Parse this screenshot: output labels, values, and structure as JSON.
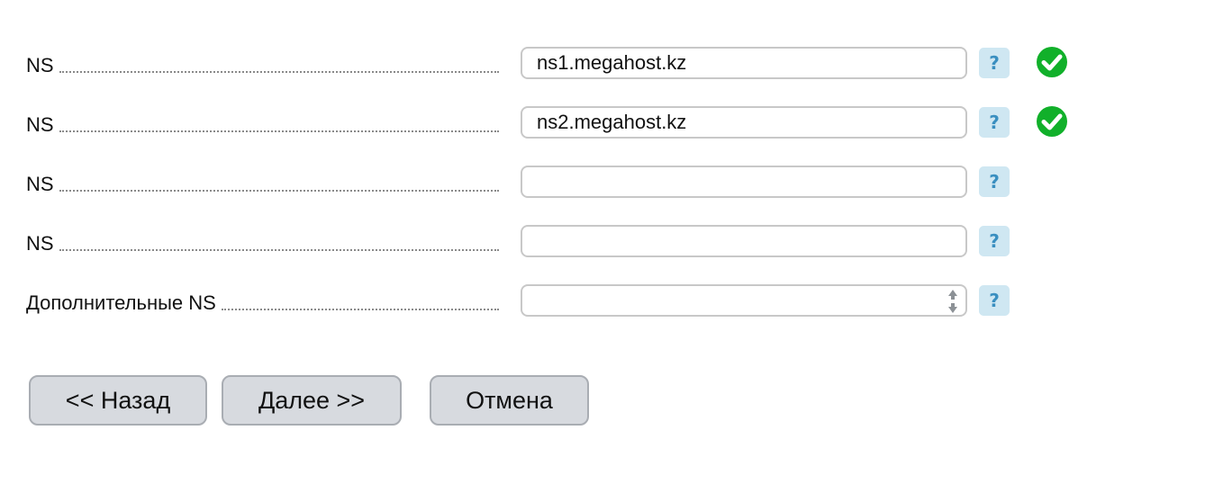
{
  "help_glyph": "?",
  "rows": [
    {
      "label": "NS",
      "value": "ns1.megahost.kz",
      "placeholder": "",
      "status": "valid"
    },
    {
      "label": "NS",
      "value": "ns2.megahost.kz",
      "placeholder": "",
      "status": "valid"
    },
    {
      "label": "NS",
      "value": "",
      "placeholder": "",
      "status": ""
    },
    {
      "label": "NS",
      "value": "",
      "placeholder": "",
      "status": ""
    },
    {
      "label": "Дополнительные NS",
      "value": "",
      "placeholder": "",
      "status": "",
      "control": "textarea-with-spinner"
    }
  ],
  "buttons": {
    "back_label": "<< Назад",
    "next_label": "Далее >>",
    "cancel_label": "Отмена"
  },
  "icons": {
    "help": "question-mark-icon",
    "valid": "green-checkmark-icon",
    "spinner": "up-down-arrows-icon"
  },
  "colors": {
    "check_green": "#11b02a",
    "help_bg": "#cfe7f2",
    "help_fg": "#3a8fc0",
    "button_bg": "#d7dadf",
    "button_border": "#a9adb3",
    "field_border": "#c8c8c8"
  }
}
